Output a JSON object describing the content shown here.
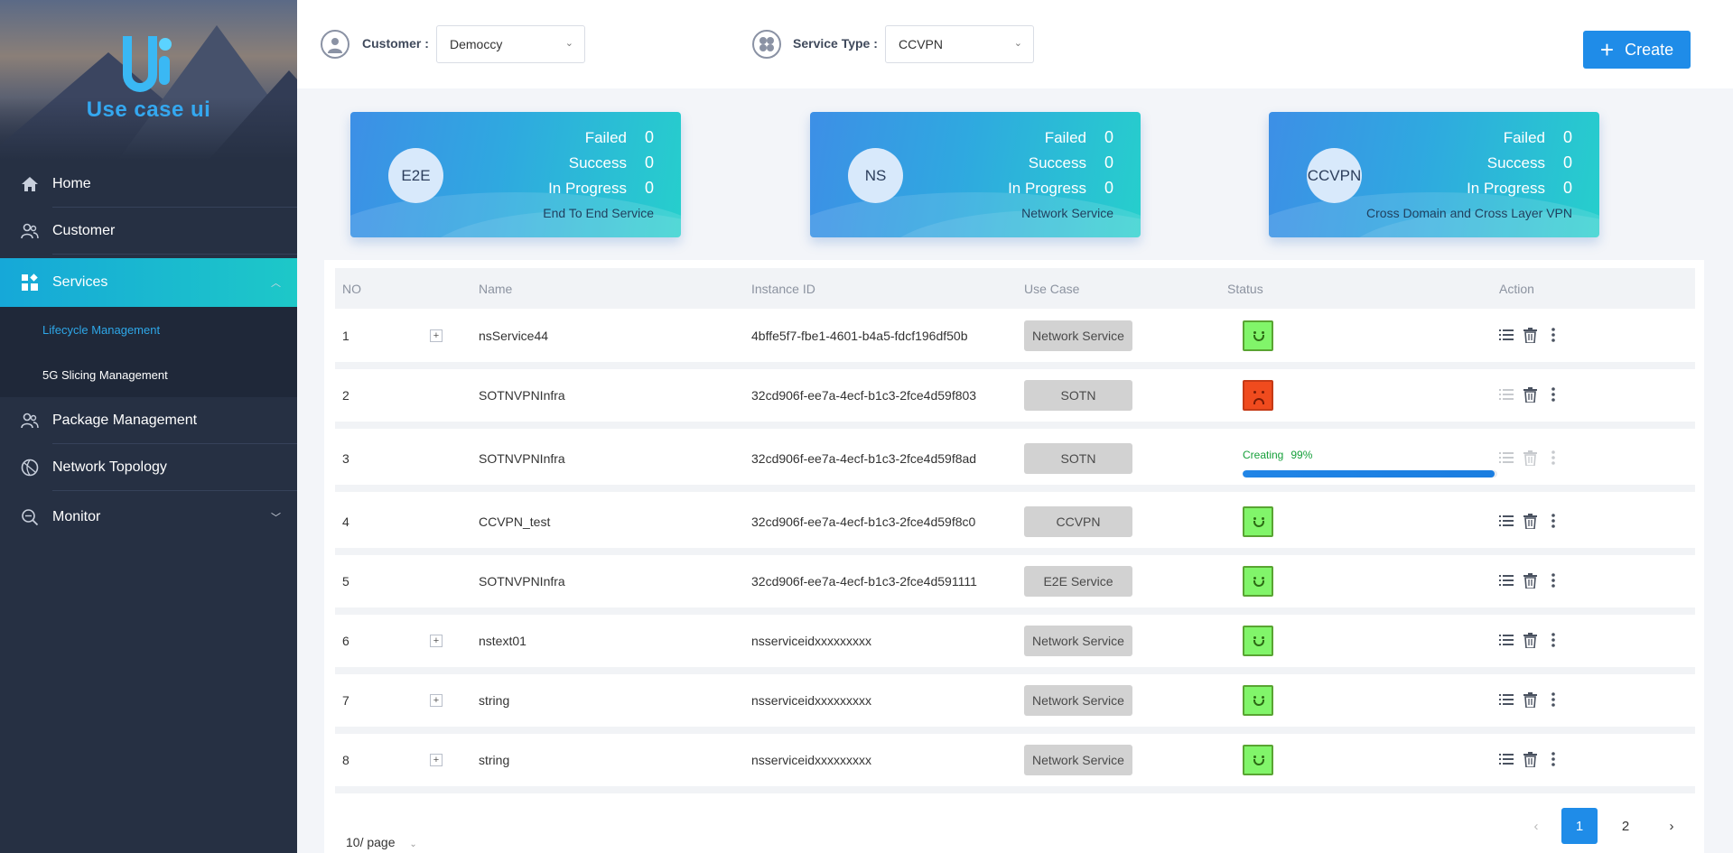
{
  "app": {
    "title": "Use case ui"
  },
  "nav": {
    "home": "Home",
    "customer": "Customer",
    "services": "Services",
    "sub_lifecycle": "Lifecycle Management",
    "sub_slicing": "5G Slicing Management",
    "package": "Package Management",
    "topology": "Network Topology",
    "monitor": "Monitor"
  },
  "filters": {
    "customer_label": "Customer :",
    "customer_value": "Democcy",
    "service_label": "Service Type :",
    "service_value": "CCVPN",
    "create_label": "Create"
  },
  "cards": [
    {
      "badge": "E2E",
      "failed_label": "Failed",
      "failed": "0",
      "success_label": "Success",
      "success": "0",
      "progress_label": "In Progress",
      "progress": "0",
      "desc": "End To End Service"
    },
    {
      "badge": "NS",
      "failed_label": "Failed",
      "failed": "0",
      "success_label": "Success",
      "success": "0",
      "progress_label": "In Progress",
      "progress": "0",
      "desc": "Network Service"
    },
    {
      "badge": "CCVPN",
      "failed_label": "Failed",
      "failed": "0",
      "success_label": "Success",
      "success": "0",
      "progress_label": "In Progress",
      "progress": "0",
      "desc": "Cross Domain and Cross Layer VPN"
    }
  ],
  "table": {
    "headers": {
      "no": "NO",
      "name": "Name",
      "instance": "Instance ID",
      "usecase": "Use Case",
      "status": "Status",
      "action": "Action"
    },
    "rows": [
      {
        "no": "1",
        "expand": "+",
        "name": "nsService44",
        "instance": "4bffe5f7-fbe1-4601-b4a5-fdcf196df50b",
        "usecase": "Network Service",
        "status": "success"
      },
      {
        "no": "2",
        "expand": "",
        "name": "SOTNVPNInfra",
        "instance": "32cd906f-ee7a-4ecf-b1c3-2fce4d59f803",
        "usecase": "SOTN",
        "status": "failed"
      },
      {
        "no": "3",
        "expand": "",
        "name": "SOTNVPNInfra",
        "instance": "32cd906f-ee7a-4ecf-b1c3-2fce4d59f8ad",
        "usecase": "SOTN",
        "status": "creating",
        "progress_label": "Creating",
        "progress_text": "99%",
        "progress": 0.99
      },
      {
        "no": "4",
        "expand": "",
        "name": "CCVPN_test",
        "instance": "32cd906f-ee7a-4ecf-b1c3-2fce4d59f8c0",
        "usecase": "CCVPN",
        "status": "success"
      },
      {
        "no": "5",
        "expand": "",
        "name": "SOTNVPNInfra",
        "instance": "32cd906f-ee7a-4ecf-b1c3-2fce4d591111",
        "usecase": "E2E Service",
        "status": "success"
      },
      {
        "no": "6",
        "expand": "+",
        "name": "nstext01",
        "instance": "nsserviceidxxxxxxxxx",
        "usecase": "Network Service",
        "status": "success"
      },
      {
        "no": "7",
        "expand": "+",
        "name": "string",
        "instance": "nsserviceidxxxxxxxxx",
        "usecase": "Network Service",
        "status": "success"
      },
      {
        "no": "8",
        "expand": "+",
        "name": "string",
        "instance": "nsserviceidxxxxxxxxx",
        "usecase": "Network Service",
        "status": "success"
      }
    ]
  },
  "pagination": {
    "page_size": "10/ page",
    "pages": [
      "1",
      "2"
    ],
    "current": "1",
    "prev": "‹",
    "next": "›"
  },
  "colors": {
    "accent": "#1f8ce8",
    "sidebar": "#263043",
    "success_face": "#81f56a",
    "failed_face": "#f04b1e",
    "progress_text": "#17a03b"
  }
}
